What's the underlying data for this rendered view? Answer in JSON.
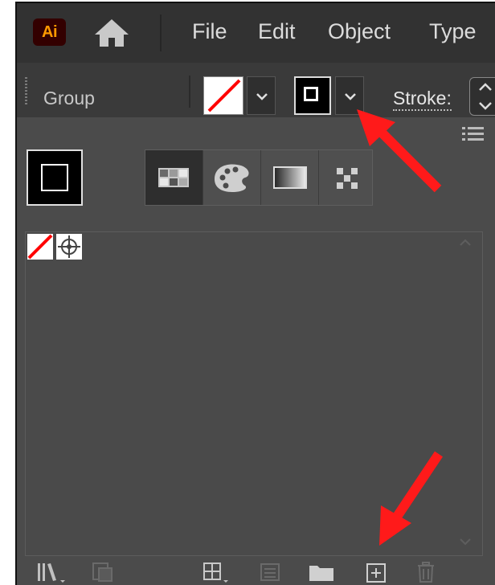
{
  "app": {
    "logo_text": "Ai"
  },
  "menu": {
    "items": [
      "File",
      "Edit",
      "Object",
      "Type"
    ]
  },
  "control_bar": {
    "selection_label": "Group",
    "stroke_label": "Stroke:"
  },
  "colors": {
    "annotation_arrow": "#ff1a1a",
    "panel_bg": "#4b4b4b",
    "menubar_bg": "#323232",
    "none_slash": "#ff0000"
  },
  "icons": {
    "home": "home-icon",
    "panel_menu": "panel-menu-icon",
    "tabs": [
      "show-color-swatches-icon",
      "color-groups-icon",
      "gradient-swatches-icon",
      "pattern-swatches-icon"
    ],
    "bottom": [
      "swatch-libraries-icon",
      "place-swatches-icon",
      "show-swatch-kinds-icon",
      "swatch-options-icon",
      "new-color-group-icon",
      "new-swatch-icon",
      "delete-swatch-icon"
    ]
  }
}
